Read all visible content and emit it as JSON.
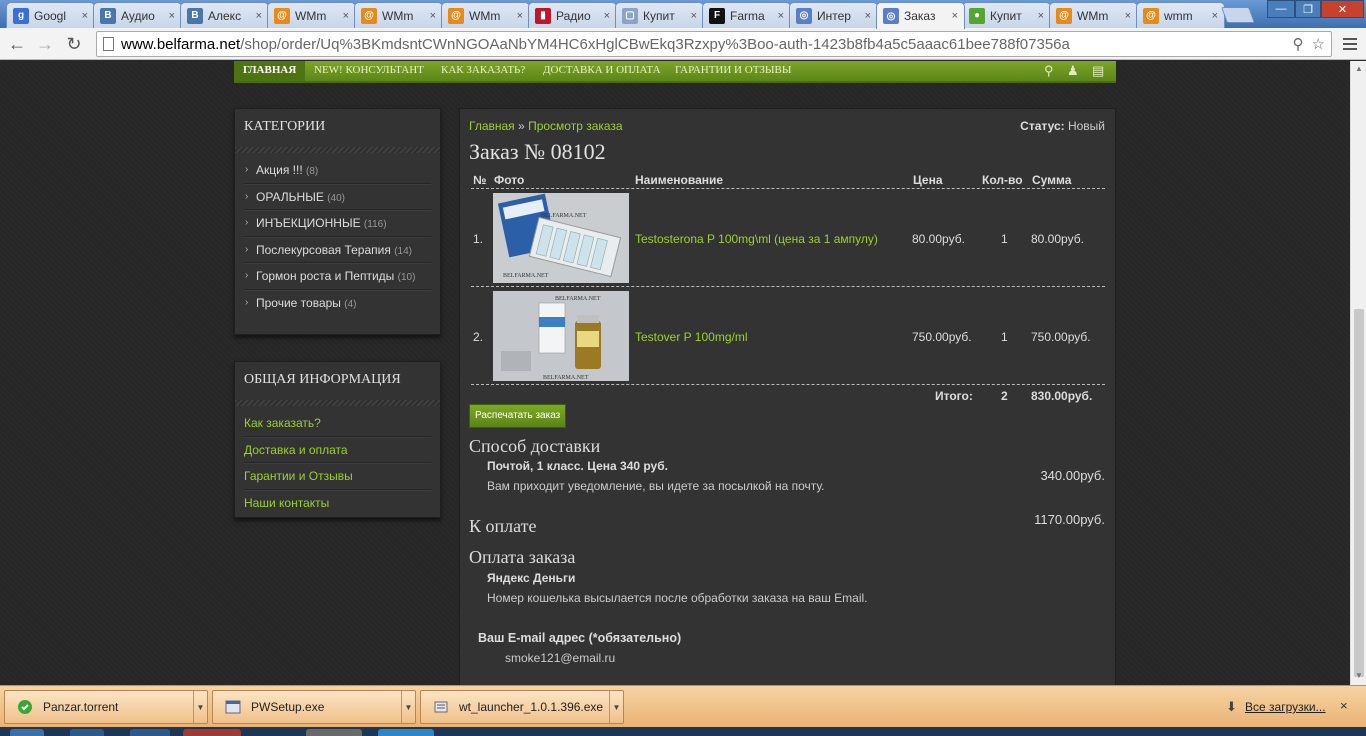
{
  "browser": {
    "tabs": [
      {
        "title": "Googl",
        "fav_color": "#3a6fd8",
        "fav_glyph": "g"
      },
      {
        "title": "Аудио",
        "fav_color": "#4a76a8",
        "fav_glyph": "В"
      },
      {
        "title": "Алекс",
        "fav_color": "#4a76a8",
        "fav_glyph": "В"
      },
      {
        "title": "WMm",
        "fav_color": "#e88a1a",
        "fav_glyph": "@"
      },
      {
        "title": "WMm",
        "fav_color": "#e88a1a",
        "fav_glyph": "@"
      },
      {
        "title": "WMm",
        "fav_color": "#e88a1a",
        "fav_glyph": "@"
      },
      {
        "title": "Радио",
        "fav_color": "#c0162b",
        "fav_glyph": "▮"
      },
      {
        "title": "Купит",
        "fav_color": "#8aa4c8",
        "fav_glyph": "▢"
      },
      {
        "title": "Farma",
        "fav_color": "#111111",
        "fav_glyph": "F"
      },
      {
        "title": "Интер",
        "fav_color": "#5a7fc4",
        "fav_glyph": "◎"
      },
      {
        "title": "Заказ",
        "fav_color": "#5a7fc4",
        "fav_glyph": "◎"
      },
      {
        "title": "Купит",
        "fav_color": "#55a630",
        "fav_glyph": "●"
      },
      {
        "title": "WMm",
        "fav_color": "#e88a1a",
        "fav_glyph": "@"
      },
      {
        "title": "wmm",
        "fav_color": "#e88a1a",
        "fav_glyph": "@"
      }
    ],
    "active_tab_index": 10,
    "tab_close": "×",
    "address": {
      "host": "www.belfarma.net",
      "rest": "/shop/order/Uq%3BKmdsntCWnNGOAaNbYM4HC6xHglCBwEkq3Rzxpy%3Boo-auth-1423b8fb4a5c5aaac61bee788f07356a"
    }
  },
  "site_nav": {
    "items": [
      "ГЛАВНАЯ",
      "NEW! КОНСУЛЬТАНТ",
      "КАК ЗАКАЗАТЬ?",
      "ДОСТАВКА И ОПЛАТА",
      "ГАРАНТИИ И ОТЗЫВЫ"
    ]
  },
  "categories": {
    "title": "КАТЕГОРИИ",
    "items": [
      {
        "label": "Акция !!!",
        "count": "(8)"
      },
      {
        "label": "ОРАЛЬНЫЕ",
        "count": "(40)"
      },
      {
        "label": "ИНЪЕКЦИОННЫЕ",
        "count": "(116)"
      },
      {
        "label": "Послекурсовая Терапия",
        "count": "(14)"
      },
      {
        "label": "Гормон роста и Пептиды",
        "count": "(10)"
      },
      {
        "label": "Прочие товары",
        "count": "(4)"
      }
    ]
  },
  "info": {
    "title": "ОБЩАЯ ИНФОРМАЦИЯ",
    "items": [
      "Как заказать?",
      "Доставка и оплата",
      "Гарантии и Отзывы",
      "Наши контакты"
    ]
  },
  "order": {
    "breadcrumb_home": "Главная",
    "breadcrumb_sep": "»",
    "breadcrumb_current": "Просмотр заказа",
    "status_label": "Статус:",
    "status_value": "Новый",
    "title": "Заказ № 08102",
    "columns": {
      "num": "№",
      "photo": "Фото",
      "name": "Наименование",
      "price": "Цена",
      "qty": "Кол-во",
      "sum": "Сумма"
    },
    "rows": [
      {
        "num": "1.",
        "name": "Testosterona P 100mg\\ml (цена за 1 ампулу)",
        "price": "80.00руб.",
        "qty": "1",
        "sum": "80.00руб.",
        "photo_text": "BELFARMA.NET"
      },
      {
        "num": "2.",
        "name": "Testover P 100mg/ml",
        "price": "750.00руб.",
        "qty": "1",
        "sum": "750.00руб.",
        "photo_text": "BELFARMA.NET"
      }
    ],
    "total_label": "Итого:",
    "total_qty": "2",
    "total_sum": "830.00руб.",
    "print_button": "Распечатать заказ",
    "delivery_heading": "Способ доставки",
    "delivery_method": "Почтой, 1 класс. Цена 340 руб.",
    "delivery_note": "Вам приходит уведомление, вы идете за посылкой на почту.",
    "delivery_amount": "340.00руб.",
    "to_pay_heading": "К оплате",
    "to_pay_amount": "1170.00руб.",
    "payment_heading": "Оплата заказа",
    "payment_method": "Яндекс Деньги",
    "payment_note": "Номер кошелька высылается после обработки заказа на ваш Email.",
    "email_label": "Ваш E-mail адрес (*обязательно)",
    "email_value": "smoke121@email.ru"
  },
  "downloads": {
    "items": [
      "Panzar.torrent",
      "PWSetup.exe",
      "wt_launcher_1.0.1.396.exe"
    ],
    "all_label": "Все загрузки...",
    "close": "×"
  },
  "colors": {
    "accent_green": "#9cd22a",
    "nav_green": "#6a9420",
    "bg_dark": "#262626"
  }
}
